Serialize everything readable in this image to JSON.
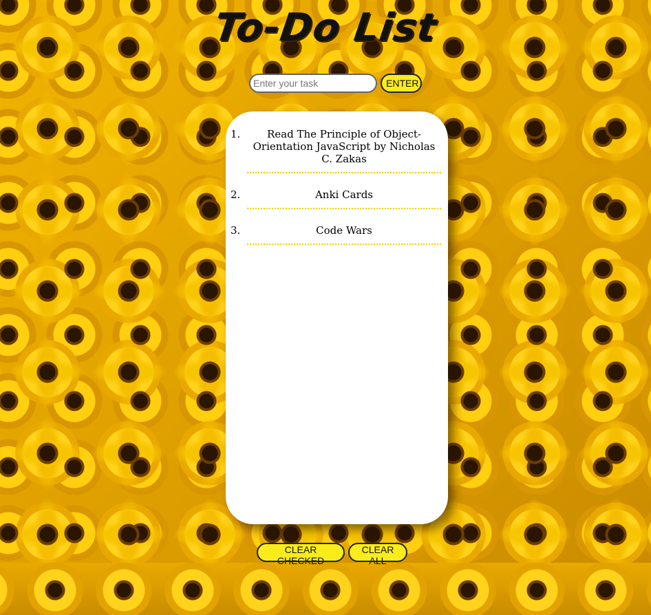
{
  "app": {
    "title": "To-Do List"
  },
  "form": {
    "input_placeholder": "Enter your task",
    "input_value": "",
    "enter_label": "ENTER"
  },
  "tasks": [
    {
      "number": "1.",
      "text": "Read The Principle of Object-Orientation JavaScript by Nicholas C. Zakas"
    },
    {
      "number": "2.",
      "text": "Anki Cards"
    },
    {
      "number": "3.",
      "text": "Code Wars"
    }
  ],
  "actions": {
    "clear_checked_label": "CLEAR CHECKED",
    "clear_all_label": "CLEAR ALL"
  },
  "colors": {
    "button_fill": "#f9ec1b",
    "divider": "#f2cc00",
    "card": "#ffffff",
    "background": "sunflower-field"
  }
}
